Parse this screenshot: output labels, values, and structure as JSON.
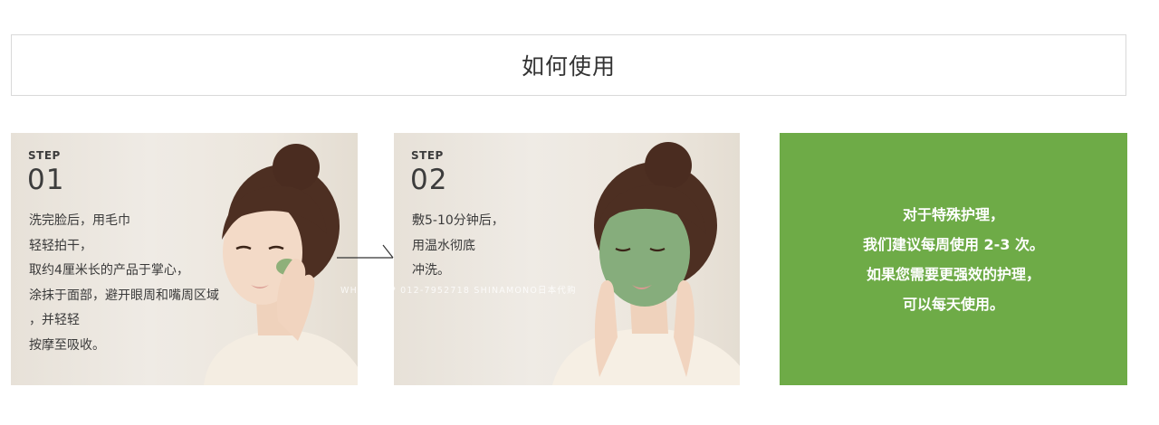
{
  "header": {
    "title": "如何使用"
  },
  "steps": [
    {
      "label": "STEP",
      "number": "01",
      "lines": [
        "洗完脸后，用毛巾",
        "轻轻拍干，",
        "取约4厘米长的产品于掌心，",
        "涂抹于面部，避开眼周和嘴周区域",
        "，并轻轻",
        "按摩至吸收。"
      ]
    },
    {
      "label": "STEP",
      "number": "02",
      "lines": [
        "敷5-10分钟后，",
        "用温水彻底",
        "冲洗。"
      ]
    }
  ],
  "special": {
    "lines": [
      "对于特殊护理，",
      "我们建议每周使用 2-3 次。",
      "如果您需要更强效的护理，",
      "可以每天使用。"
    ]
  },
  "watermark": {
    "text": "WHATSAPP 012-7952718  SHINAMONO日本代购"
  },
  "colors": {
    "accent_green": "#6eab47",
    "mask_green": "#7fa877",
    "text_dark": "#3c3c3c",
    "border": "#d9d9d9"
  }
}
